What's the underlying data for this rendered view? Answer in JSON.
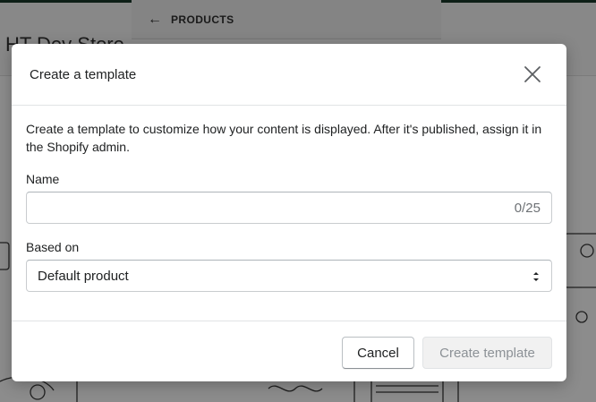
{
  "background": {
    "store_name": "HT Dev Store",
    "breadcrumb_label": "PRODUCTS",
    "breadcrumb_icon": "arrow-left-icon"
  },
  "modal": {
    "title": "Create a template",
    "close_icon": "close-icon",
    "description": "Create a template to customize how your content is displayed. After it's published, assign it in the Shopify admin.",
    "name_field": {
      "label": "Name",
      "value": "",
      "char_count": "0/25"
    },
    "based_on_field": {
      "label": "Based on",
      "selected": "Default product",
      "icon": "select-arrows-icon"
    },
    "footer": {
      "cancel_label": "Cancel",
      "create_label": "Create template"
    }
  },
  "colors": {
    "scrim": "#000000",
    "text": "#202223",
    "subdued_text": "#6d7175",
    "disabled_button_bg": "#f1f1f1",
    "border": "#c9cccf"
  }
}
